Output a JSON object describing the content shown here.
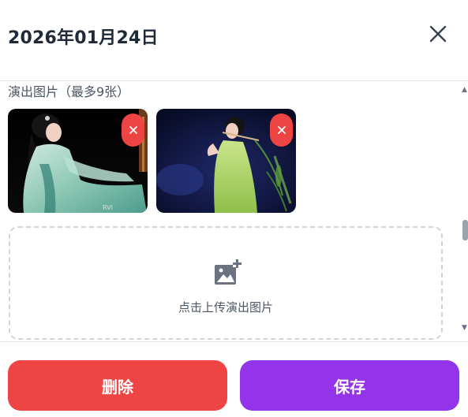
{
  "header": {
    "title": "2026年01月24日",
    "close_icon": "close-icon"
  },
  "photos": {
    "label": "演出图片（最多9张）",
    "items": [
      {
        "alt": "performer in teal costume",
        "remove_icon": "close-icon"
      },
      {
        "alt": "performer in green costume",
        "remove_icon": "close-icon"
      }
    ],
    "upload_icon": "add-photo-icon",
    "upload_text": "点击上传演出图片"
  },
  "footer": {
    "delete_label": "删除",
    "save_label": "保存"
  },
  "colors": {
    "danger": "#ef4444",
    "primary": "#9333ea",
    "text": "#1f2937",
    "muted": "#4b5563",
    "border": "#d1d5db"
  }
}
